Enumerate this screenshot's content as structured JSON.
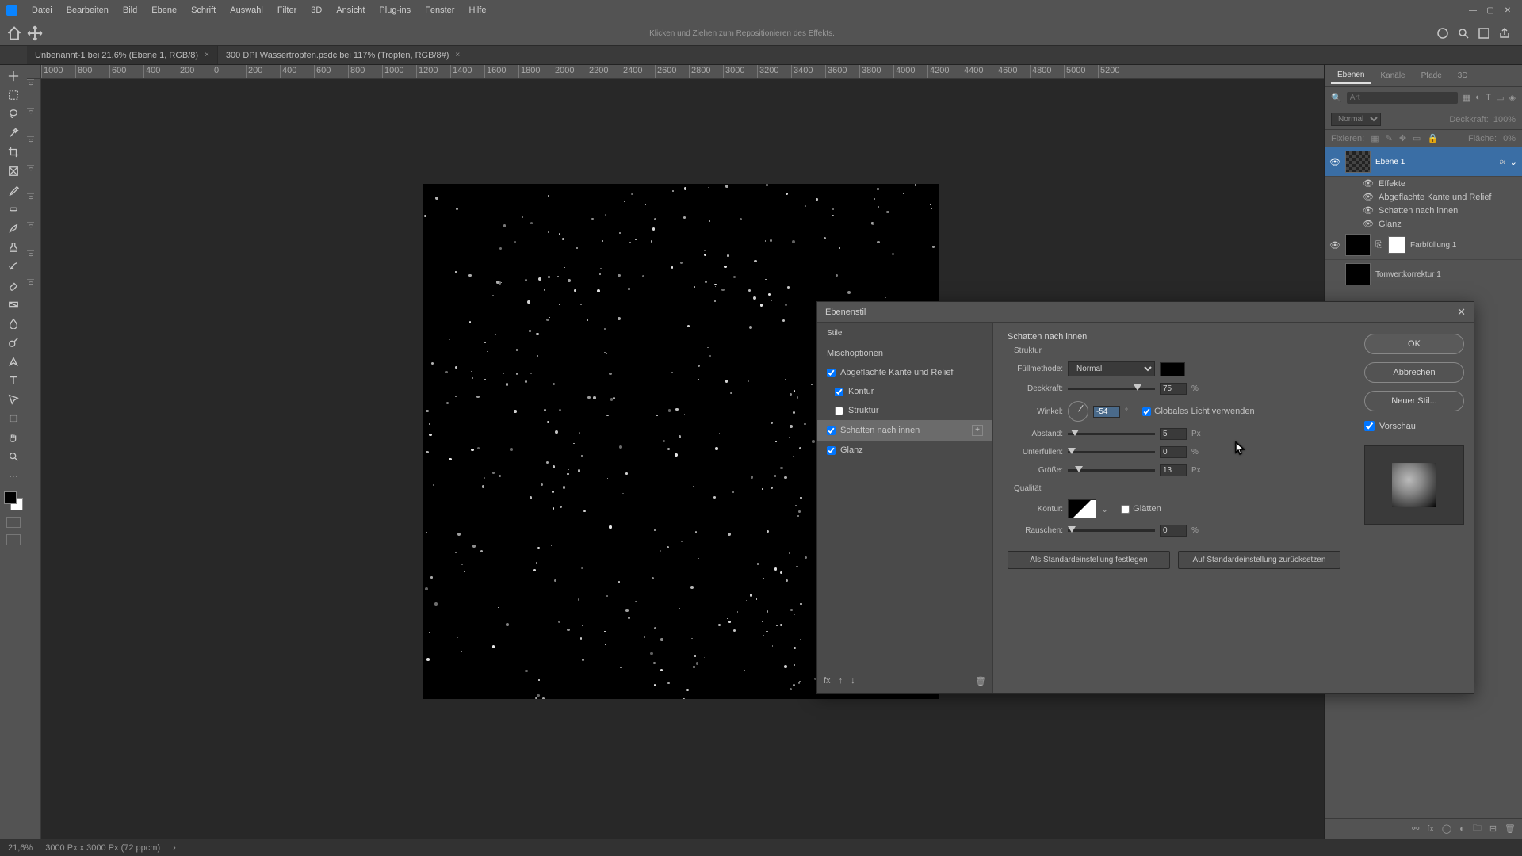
{
  "menubar": {
    "items": [
      "Datei",
      "Bearbeiten",
      "Bild",
      "Ebene",
      "Schrift",
      "Auswahl",
      "Filter",
      "3D",
      "Ansicht",
      "Plug-ins",
      "Fenster",
      "Hilfe"
    ]
  },
  "optionsbar": {
    "hint": "Klicken und Ziehen zum Repositionieren des Effekts."
  },
  "tabs": [
    {
      "label": "Unbenannt-1 bei 21,6% (Ebene 1, RGB/8)",
      "active": true
    },
    {
      "label": "300 DPI Wassertropfen.psdc bei 117% (Tropfen, RGB/8#)",
      "active": false
    }
  ],
  "ruler_h": [
    "1000",
    "800",
    "600",
    "400",
    "200",
    "0",
    "200",
    "400",
    "600",
    "800",
    "1000",
    "1200",
    "1400",
    "1600",
    "1800",
    "2000",
    "2200",
    "2400",
    "2600",
    "2800",
    "3000",
    "3200",
    "3400",
    "3600",
    "3800",
    "4000",
    "4200",
    "4400",
    "4600",
    "4800",
    "5000",
    "5200"
  ],
  "ruler_v": [
    "0",
    "0",
    "0",
    "0",
    "0",
    "0",
    "0",
    "0"
  ],
  "panels": {
    "tabs": [
      "Ebenen",
      "Kanäle",
      "Pfade",
      "3D"
    ],
    "search_placeholder": "Art",
    "blend": "Normal",
    "opacity_label": "Deckkraft:",
    "opacity_val": "100%",
    "lock_label": "Fixieren:",
    "fill_label": "Fläche:",
    "fill_val": "0%",
    "layers": [
      {
        "name": "Ebene 1",
        "fx": "fx",
        "selected": true
      },
      {
        "name": "Farbfüllung 1"
      },
      {
        "name": "Tonwertkorrektur 1"
      }
    ],
    "effects": {
      "title": "Effekte",
      "items": [
        "Abgeflachte Kante und Relief",
        "Schatten nach innen",
        "Glanz"
      ]
    }
  },
  "statusbar": {
    "zoom": "21,6%",
    "docinfo": "3000 Px x 3000 Px (72 ppcm)"
  },
  "dialog": {
    "title": "Ebenenstil",
    "left": {
      "header": "Stile",
      "blend_options": "Mischoptionen",
      "items": [
        {
          "label": "Abgeflachte Kante und Relief",
          "checked": true,
          "sub": false
        },
        {
          "label": "Kontur",
          "checked": true,
          "sub": true
        },
        {
          "label": "Struktur",
          "checked": false,
          "sub": true
        },
        {
          "label": "Schatten nach innen",
          "checked": true,
          "sub": false,
          "selected": true,
          "plus": true
        },
        {
          "label": "Glanz",
          "checked": true,
          "sub": false
        }
      ]
    },
    "center": {
      "title": "Schatten nach innen",
      "struktur": "Struktur",
      "fill_label": "Füllmethode:",
      "fill_mode": "Normal",
      "opacity_label": "Deckkraft:",
      "opacity_val": "75",
      "opacity_unit": "%",
      "angle_label": "Winkel:",
      "angle_val": "-54",
      "angle_unit": "°",
      "global_light": "Globales Licht verwenden",
      "distance_label": "Abstand:",
      "distance_val": "5",
      "distance_unit": "Px",
      "choke_label": "Unterfüllen:",
      "choke_val": "0",
      "choke_unit": "%",
      "size_label": "Größe:",
      "size_val": "13",
      "size_unit": "Px",
      "quality": "Qualität",
      "contour_label": "Kontur:",
      "antialias": "Glätten",
      "noise_label": "Rauschen:",
      "noise_val": "0",
      "noise_unit": "%",
      "make_default": "Als Standardeinstellung festlegen",
      "reset_default": "Auf Standardeinstellung zurücksetzen"
    },
    "right": {
      "ok": "OK",
      "cancel": "Abbrechen",
      "new_style": "Neuer Stil...",
      "preview": "Vorschau"
    }
  }
}
